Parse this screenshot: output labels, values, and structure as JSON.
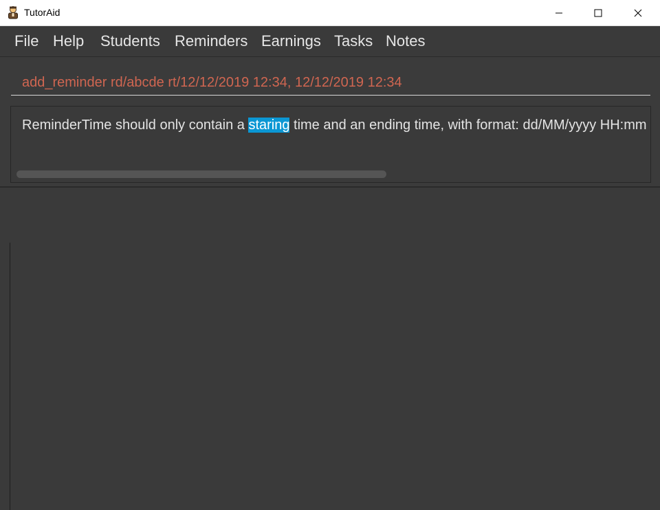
{
  "window": {
    "title": "TutorAid",
    "app_icon": "tutor-avatar-icon",
    "controls": {
      "minimize_icon": "minimize-icon",
      "maximize_icon": "maximize-icon",
      "close_icon": "close-icon"
    }
  },
  "menu": {
    "items": [
      {
        "label": "File"
      },
      {
        "label": "Help"
      },
      {
        "label": "Students"
      },
      {
        "label": "Reminders"
      },
      {
        "label": "Earnings"
      },
      {
        "label": "Tasks"
      },
      {
        "label": "Notes"
      }
    ]
  },
  "command": {
    "value": "add_reminder rd/abcde rt/12/12/2019 12:34, 12/12/2019 12:34",
    "text_color": "#d06651"
  },
  "result": {
    "before": "ReminderTime should only contain a ",
    "highlighted": "staring",
    "after": " time and an ending time, with format: dd/MM/yyyy HH:mm",
    "highlight_color": "#0b97d4"
  },
  "colors": {
    "background": "#3a3a3a",
    "text": "#e6e6e6"
  }
}
